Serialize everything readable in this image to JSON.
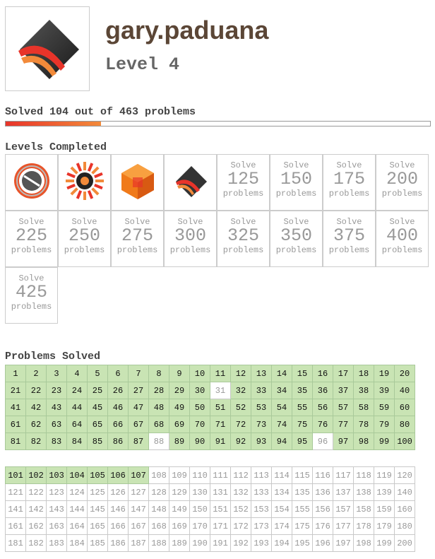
{
  "profile": {
    "username": "gary.paduana",
    "level": "Level 4",
    "avatar_icon": "diamond-logo"
  },
  "progress": {
    "text": "Solved 104 out of 463 problems",
    "solved": 104,
    "total": 463
  },
  "levels": {
    "title": "Levels Completed",
    "completed_icons": [
      "orange-ring-badge-icon",
      "sunburst-badge-icon",
      "orange-cube-badge-icon",
      "diamond-swoosh-badge-icon"
    ],
    "pending": [
      {
        "label": "Solve",
        "count": "125",
        "unit": "problems"
      },
      {
        "label": "Solve",
        "count": "150",
        "unit": "problems"
      },
      {
        "label": "Solve",
        "count": "175",
        "unit": "problems"
      },
      {
        "label": "Solve",
        "count": "200",
        "unit": "problems"
      },
      {
        "label": "Solve",
        "count": "225",
        "unit": "problems"
      },
      {
        "label": "Solve",
        "count": "250",
        "unit": "problems"
      },
      {
        "label": "Solve",
        "count": "275",
        "unit": "problems"
      },
      {
        "label": "Solve",
        "count": "300",
        "unit": "problems"
      },
      {
        "label": "Solve",
        "count": "325",
        "unit": "problems"
      },
      {
        "label": "Solve",
        "count": "350",
        "unit": "problems"
      },
      {
        "label": "Solve",
        "count": "375",
        "unit": "problems"
      },
      {
        "label": "Solve",
        "count": "400",
        "unit": "problems"
      },
      {
        "label": "Solve",
        "count": "425",
        "unit": "problems"
      }
    ]
  },
  "problems": {
    "title": "Problems Solved",
    "first": 1,
    "last": 200,
    "unsolved_below_101": [
      31,
      88,
      96
    ],
    "solved_from_101": [
      101,
      102,
      103,
      104,
      105,
      106,
      107
    ]
  },
  "colors": {
    "solved_bg": "#c9e4b4",
    "progress_start": "#e8342a",
    "progress_end": "#f28a3a",
    "username": "#5b4636"
  }
}
